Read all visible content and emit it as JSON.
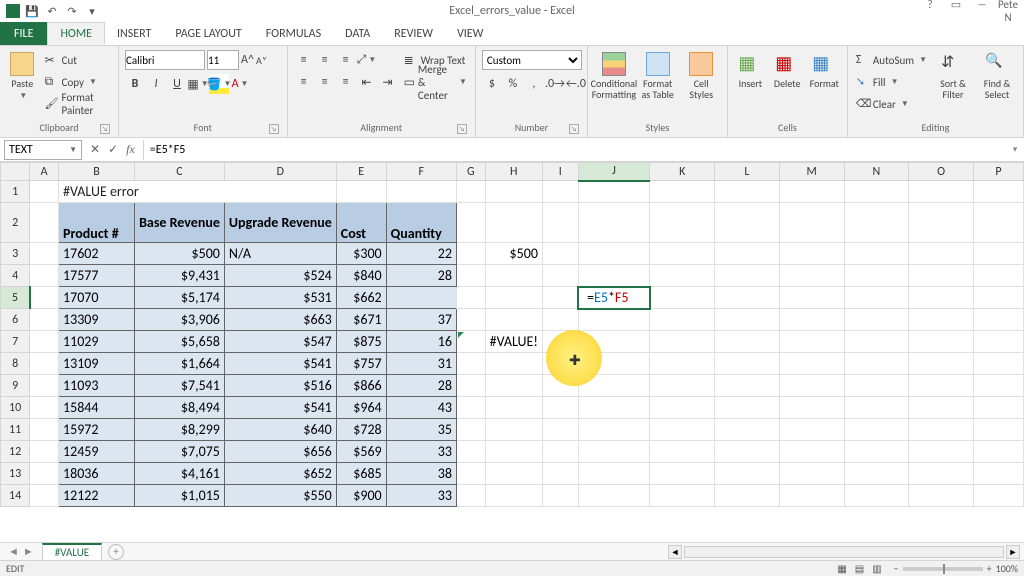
{
  "window": {
    "title": "Excel_errors_value - Excel",
    "user": "Pete N"
  },
  "qat": {
    "save": "💾",
    "undo": "↶",
    "redo": "↷",
    "more": "▾"
  },
  "tabs": {
    "file": "FILE",
    "home": "HOME",
    "insert": "INSERT",
    "pagelayout": "PAGE LAYOUT",
    "formulas": "FORMULAS",
    "data": "DATA",
    "review": "REVIEW",
    "view": "VIEW"
  },
  "ribbon": {
    "clipboard": {
      "label": "Clipboard",
      "paste": "Paste",
      "cut": "Cut",
      "copy": "Copy",
      "painter": "Format Painter"
    },
    "font": {
      "label": "Font",
      "name": "Calibri",
      "size": "11",
      "bold": "B",
      "italic": "I",
      "under": "U"
    },
    "alignment": {
      "label": "Alignment",
      "wrap": "Wrap Text",
      "merge": "Merge & Center"
    },
    "number": {
      "label": "Number",
      "format": "Custom",
      "currency": "$",
      "percent": "%",
      "comma": ",",
      "incdec": "←.0 .00→"
    },
    "styles": {
      "label": "Styles",
      "cond": "Conditional Formatting",
      "table": "Format as Table",
      "cell": "Cell Styles"
    },
    "cells": {
      "label": "Cells",
      "insert": "Insert",
      "delete": "Delete",
      "format": "Format"
    },
    "editing": {
      "label": "Editing",
      "sum": "AutoSum",
      "fill": "Fill",
      "clear": "Clear",
      "sort": "Sort & Filter",
      "find": "Find & Select"
    }
  },
  "fbar": {
    "name": "TEXT",
    "cancel": "✕",
    "enter": "✓",
    "fx": "fx",
    "formula": "=E5*F5"
  },
  "columns": [
    "",
    "A",
    "B",
    "C",
    "D",
    "E",
    "F",
    "G",
    "H",
    "I",
    "J",
    "K",
    "L",
    "M",
    "N",
    "O",
    "P"
  ],
  "rows": [
    "1",
    "2",
    "3",
    "4",
    "5",
    "6",
    "7",
    "8",
    "9",
    "10",
    "11",
    "12",
    "13",
    "14"
  ],
  "sheet": {
    "title": "#VALUE error",
    "headers": {
      "product": "Product #",
      "base": "Base Revenue",
      "upgrade": "Upgrade Revenue",
      "cost": "Cost",
      "qty": "Quantity"
    },
    "data": [
      {
        "p": "17602",
        "b": "$500",
        "u": "N/A",
        "c": "$300",
        "q": "22"
      },
      {
        "p": "17577",
        "b": "$9,431",
        "u": "$524",
        "c": "$840",
        "q": "28"
      },
      {
        "p": "17070",
        "b": "$5,174",
        "u": "$531",
        "c": "$662",
        "q": ""
      },
      {
        "p": "13309",
        "b": "$3,906",
        "u": "$663",
        "c": "$671",
        "q": "37"
      },
      {
        "p": "11029",
        "b": "$5,658",
        "u": "$547",
        "c": "$875",
        "q": "16"
      },
      {
        "p": "13109",
        "b": "$1,664",
        "u": "$541",
        "c": "$757",
        "q": "31"
      },
      {
        "p": "11093",
        "b": "$7,541",
        "u": "$516",
        "c": "$866",
        "q": "28"
      },
      {
        "p": "15844",
        "b": "$8,494",
        "u": "$541",
        "c": "$964",
        "q": "43"
      },
      {
        "p": "15972",
        "b": "$8,299",
        "u": "$640",
        "c": "$728",
        "q": "35"
      },
      {
        "p": "12459",
        "b": "$7,075",
        "u": "$656",
        "c": "$569",
        "q": "33"
      },
      {
        "p": "18036",
        "b": "$4,161",
        "u": "$652",
        "c": "$685",
        "q": "38"
      },
      {
        "p": "12122",
        "b": "$1,015",
        "u": "$550",
        "c": "$900",
        "q": "33"
      }
    ],
    "h3": "$500",
    "h7": "#VALUE!",
    "j5_edit_prefix": "=",
    "j5_edit_ref1": "E5",
    "j5_edit_op": "*",
    "j5_edit_ref2": "F5"
  },
  "sheettab": {
    "name": "#VALUE",
    "add": "+"
  },
  "status": {
    "mode": "EDIT",
    "zoom": "100%"
  }
}
